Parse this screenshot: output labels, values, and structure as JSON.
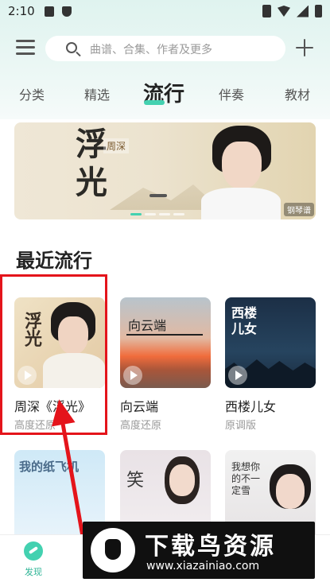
{
  "status_bar": {
    "time": "2:10"
  },
  "search": {
    "placeholder": "曲谱、合集、作者及更多"
  },
  "tabs": [
    {
      "label": "分类"
    },
    {
      "label": "精选"
    },
    {
      "label": "流行",
      "active": true
    },
    {
      "label": "伴奏"
    },
    {
      "label": "教材"
    }
  ],
  "banner": {
    "title": "浮光",
    "artist": "周深",
    "badge": "钢琴谱"
  },
  "section": {
    "title": "最近流行"
  },
  "songs": [
    {
      "cover_text": "浮光",
      "name": "周深《浮光》",
      "sub": "高度还原"
    },
    {
      "cover_text": "向云端",
      "name": "向云端",
      "sub": "高度还原"
    },
    {
      "cover_text": "西楼儿女",
      "name": "西楼儿女",
      "sub": "原调版"
    },
    {
      "cover_text": "我的纸飞机",
      "name": "",
      "sub": ""
    },
    {
      "cover_text": "笑",
      "name": "",
      "sub": ""
    },
    {
      "cover_text": "我想你的不一定雪",
      "name": "",
      "sub": ""
    }
  ],
  "bottom_nav": {
    "discover": "发现"
  },
  "watermark": {
    "title": "下载鸟资源",
    "url": "www.xiazainiao.com"
  },
  "colors": {
    "accent": "#43d1b0",
    "annotation": "#e4141b"
  }
}
